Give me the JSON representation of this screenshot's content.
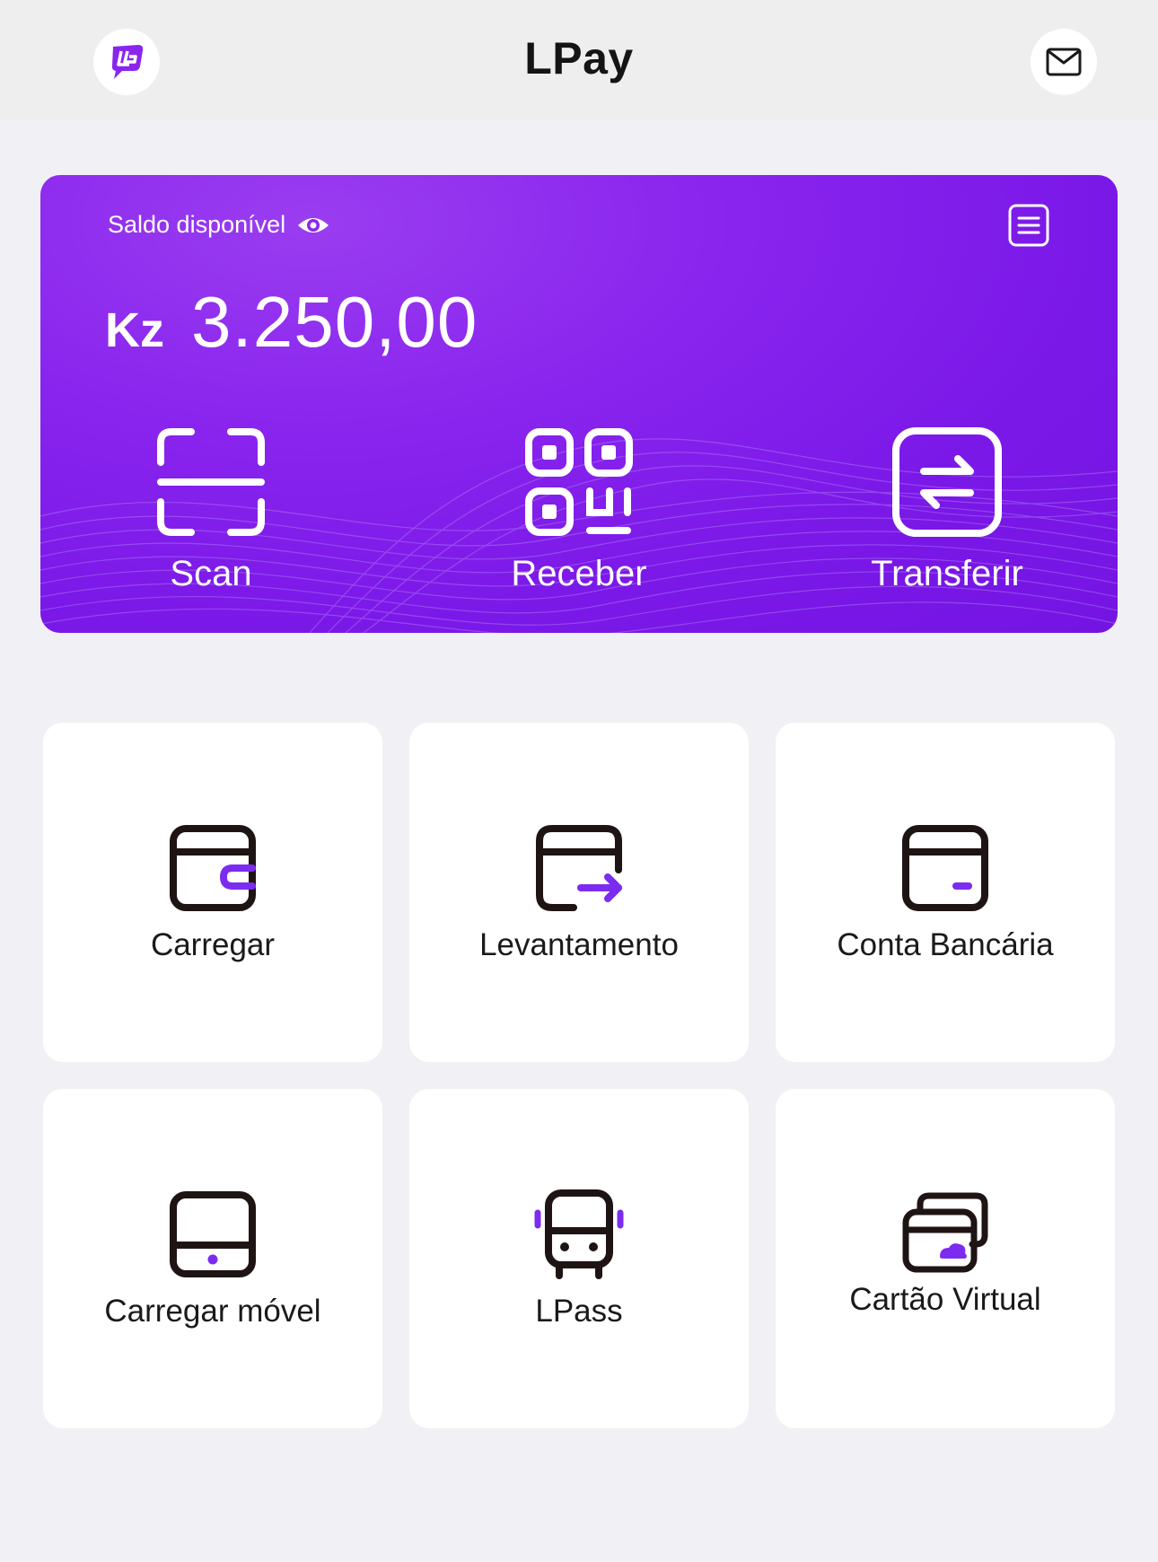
{
  "header": {
    "title": "LPay",
    "logo_icon": "lpay-logo-icon",
    "mail_icon": "mail-icon"
  },
  "balance": {
    "label": "Saldo disponível",
    "currency": "Kz",
    "amount": "3.250,00",
    "card_color": "#8a25ee"
  },
  "actions": [
    {
      "label": "Scan",
      "icon": "scan-icon"
    },
    {
      "label": "Receber",
      "icon": "qr-code-icon"
    },
    {
      "label": "Transferir",
      "icon": "transfer-icon"
    }
  ],
  "services": [
    {
      "label": "Carregar",
      "icon": "wallet-icon"
    },
    {
      "label": "Levantamento",
      "icon": "withdraw-icon"
    },
    {
      "label": "Conta Bancária",
      "icon": "bank-card-icon"
    },
    {
      "label": "Carregar móvel",
      "icon": "mobile-topup-icon"
    },
    {
      "label": "LPass",
      "icon": "bus-icon"
    },
    {
      "label": "Cartão Virtual",
      "icon": "virtual-card-icon"
    }
  ],
  "accent_color": "#7b2cf0"
}
